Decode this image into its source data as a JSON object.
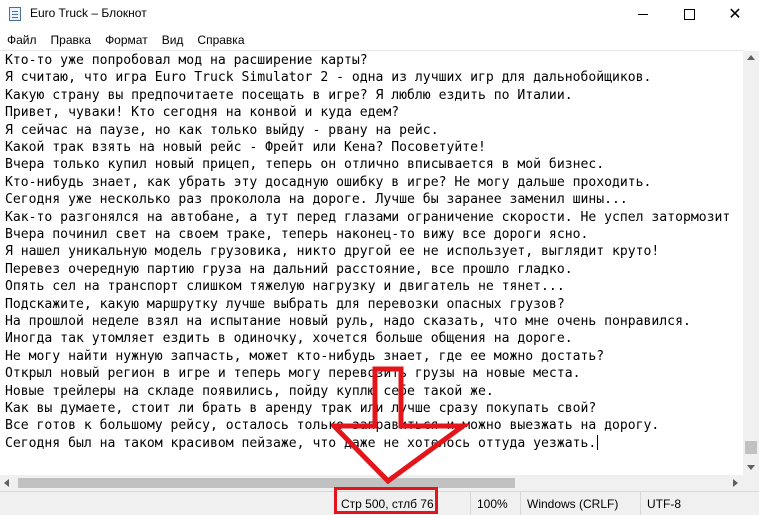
{
  "window": {
    "title": "Euro Truck – Блокнот",
    "controls": {
      "minimize": "minimize",
      "maximize": "maximize",
      "close": "✕"
    }
  },
  "menu": [
    "Файл",
    "Правка",
    "Формат",
    "Вид",
    "Справка"
  ],
  "editor": {
    "lines": [
      "Кто-то уже попробовал мод на расширение карты?",
      "Я считаю, что игра Euro Truck Simulator 2 - одна из лучших игр для дальнобойщиков.",
      "Какую страну вы предпочитаете посещать в игре? Я люблю ездить по Италии.",
      "Привет, чуваки! Кто сегодня на конвой и куда едем?",
      "Я сейчас на паузе, но как только выйду - рвану на рейс.",
      "Какой трак взять на новый рейс - Фрейт или Кена? Посоветуйте!",
      "Вчера только купил новый прицеп, теперь он отлично вписывается в мой бизнес.",
      "Кто-нибудь знает, как убрать эту досадную ошибку в игре? Не могу дальше проходить.",
      "Сегодня уже несколько раз проколола на дороге. Лучше бы заранее заменил шины...",
      "Как-то разгонялся на автобане, а тут перед глазами ограничение скорости. Не успел затормозит",
      "Вчера починил свет на своем траке, теперь наконец-то вижу все дороги ясно.",
      "Я нашел уникальную модель грузовика, никто другой ее не использует, выглядит круто!",
      "Перевез очередную партию груза на дальний расстояние, все прошло гладко.",
      "Опять сел на транспорт слишком тяжелую нагрузку и двигатель не тянет...",
      "Подскажите, какую маршрутку лучше выбрать для перевозки опасных грузов?",
      "На прошлой неделе взял на испытание новый руль, надо сказать, что мне очень понравился.",
      "Иногда так утомляет ездить в одиночку, хочется больше общения на дороге.",
      "Не могу найти нужную запчасть, может кто-нибудь знает, где ее можно достать?",
      "Открыл новый регион в игре и теперь могу перевозить грузы на новые места.",
      "Новые трейлеры на складе появились, пойду куплю себе такой же.",
      "Как вы думаете, стоит ли брать в аренду трак или лучше сразу покупать свой?",
      "Все готов к большому рейсу, осталось только заправиться и можно выезжать на дорогу.",
      "Сегодня был на таком красивом пейзаже, что даже не хотелось оттуда уезжать."
    ]
  },
  "status": {
    "position": "Стр 500, стлб 76",
    "zoom": "100%",
    "line_ending": "Windows (CRLF)",
    "encoding": "UTF-8"
  },
  "annotation": {
    "color": "#e4141b"
  }
}
